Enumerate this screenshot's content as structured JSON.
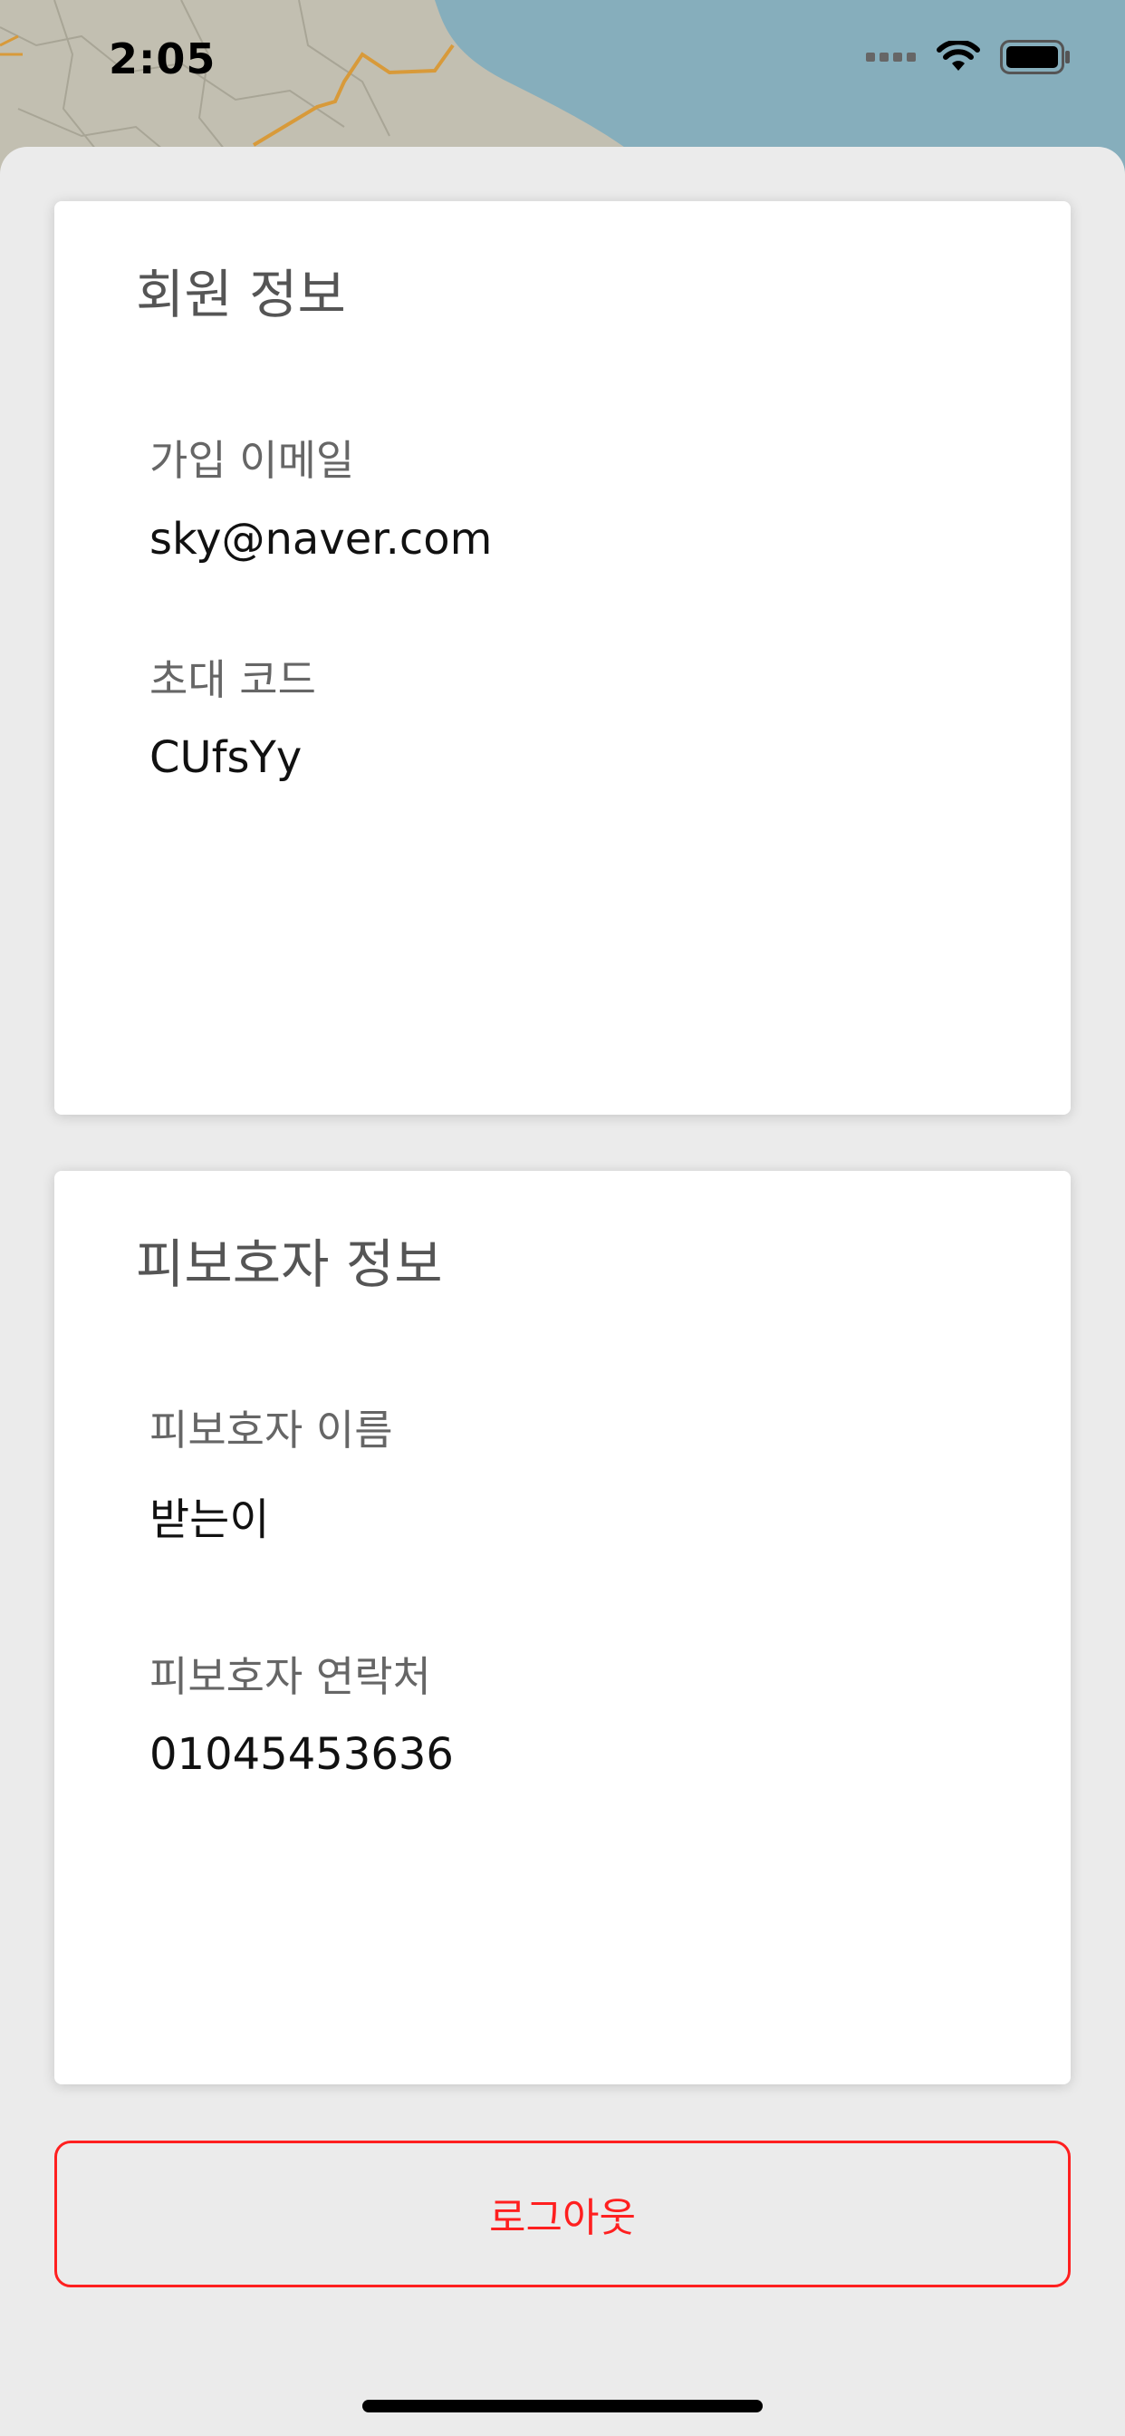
{
  "status_bar": {
    "time": "2:05",
    "icons": [
      "cellular-signal-icon",
      "wifi-icon",
      "battery-icon"
    ]
  },
  "member_card": {
    "title": "회원 정보",
    "fields": [
      {
        "label": "가입 이메일",
        "value": "sky@naver.com"
      },
      {
        "label": "초대 코드",
        "value": "CUfsYy"
      }
    ]
  },
  "ward_card": {
    "title": "피보호자 정보",
    "fields": [
      {
        "label": "피보호자 이름",
        "value": "받는이"
      },
      {
        "label": "피보호자 연락처",
        "value": "01045453636"
      }
    ]
  },
  "logout": {
    "label": "로그아웃"
  },
  "colors": {
    "accent_red": "#ff1f1f",
    "sheet_background": "#ebebeb",
    "card_background": "#ffffff",
    "map_water": "#86aebc",
    "map_land": "#c2bfb1",
    "map_road": "#d89a3a"
  }
}
